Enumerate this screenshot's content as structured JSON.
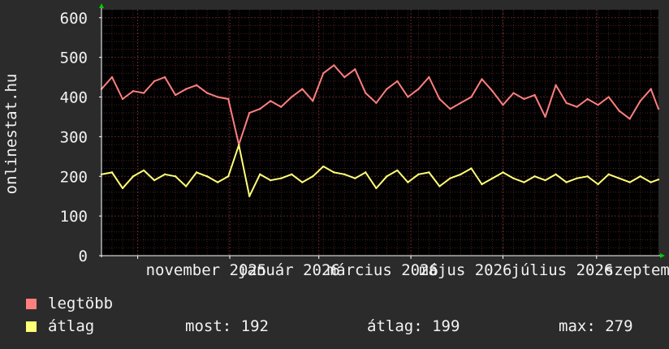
{
  "site_label": "onlinestat.hu",
  "legend": {
    "max_label": "legtöbb",
    "avg_label": "átlag",
    "now_text": "most: 192",
    "avg_text": "átlag: 199",
    "max_text": "max: 279"
  },
  "colors": {
    "background": "#2b2b2b",
    "plot_background": "#000000",
    "grid": "#4a2020",
    "max_series": "#ff7f7f",
    "avg_series": "#ffff77",
    "axis": "#ffffff",
    "arrow": "#00cc00"
  },
  "chart_data": {
    "type": "line",
    "title": "",
    "xlabel": "",
    "ylabel": "onlinestat.hu",
    "ylim": [
      0,
      620
    ],
    "yticks": [
      0,
      100,
      200,
      300,
      400,
      500,
      600
    ],
    "xlim": [
      "2025-10-08",
      "2026-10-12"
    ],
    "x_ticks": [
      {
        "date": "2025-11-01",
        "label": "november 2025"
      },
      {
        "date": "2026-01-01",
        "label": "január 2026"
      },
      {
        "date": "2026-03-01",
        "label": "március 2026"
      },
      {
        "date": "2026-05-01",
        "label": "május 2026"
      },
      {
        "date": "2026-07-01",
        "label": "július 2026"
      },
      {
        "date": "2026-09-01",
        "label": "szeptember"
      }
    ],
    "grid": true,
    "series": [
      {
        "name": "legtöbb",
        "color": "#ff7f7f",
        "x": [
          "2025-10-08",
          "2025-10-15",
          "2025-10-22",
          "2025-10-29",
          "2025-11-05",
          "2025-11-12",
          "2025-11-19",
          "2025-11-26",
          "2025-12-03",
          "2025-12-10",
          "2025-12-17",
          "2025-12-24",
          "2025-12-31",
          "2026-01-07",
          "2026-01-14",
          "2026-01-21",
          "2026-01-28",
          "2026-02-04",
          "2026-02-11",
          "2026-02-18",
          "2026-02-25",
          "2026-03-04",
          "2026-03-11",
          "2026-03-18",
          "2026-03-25",
          "2026-04-01",
          "2026-04-08",
          "2026-04-15",
          "2026-04-22",
          "2026-04-29",
          "2026-05-06",
          "2026-05-13",
          "2026-05-20",
          "2026-05-27",
          "2026-06-03",
          "2026-06-10",
          "2026-06-17",
          "2026-06-24",
          "2026-07-01",
          "2026-07-08",
          "2026-07-15",
          "2026-07-22",
          "2026-07-29",
          "2026-08-05",
          "2026-08-12",
          "2026-08-19",
          "2026-08-26",
          "2026-09-02",
          "2026-09-09",
          "2026-09-16",
          "2026-09-23",
          "2026-09-30",
          "2026-10-07",
          "2026-10-12"
        ],
        "values": [
          420,
          450,
          395,
          415,
          410,
          440,
          450,
          405,
          420,
          430,
          410,
          400,
          395,
          280,
          360,
          370,
          390,
          375,
          400,
          420,
          390,
          460,
          480,
          450,
          470,
          410,
          385,
          420,
          440,
          400,
          420,
          450,
          395,
          370,
          385,
          400,
          445,
          415,
          380,
          410,
          395,
          405,
          350,
          430,
          385,
          375,
          395,
          380,
          400,
          365,
          345,
          390,
          420,
          370
        ]
      },
      {
        "name": "átlag",
        "color": "#ffff77",
        "x": [
          "2025-10-08",
          "2025-10-15",
          "2025-10-22",
          "2025-10-29",
          "2025-11-05",
          "2025-11-12",
          "2025-11-19",
          "2025-11-26",
          "2025-12-03",
          "2025-12-10",
          "2025-12-17",
          "2025-12-24",
          "2025-12-31",
          "2026-01-07",
          "2026-01-14",
          "2026-01-21",
          "2026-01-28",
          "2026-02-04",
          "2026-02-11",
          "2026-02-18",
          "2026-02-25",
          "2026-03-04",
          "2026-03-11",
          "2026-03-18",
          "2026-03-25",
          "2026-04-01",
          "2026-04-08",
          "2026-04-15",
          "2026-04-22",
          "2026-04-29",
          "2026-05-06",
          "2026-05-13",
          "2026-05-20",
          "2026-05-27",
          "2026-06-03",
          "2026-06-10",
          "2026-06-17",
          "2026-06-24",
          "2026-07-01",
          "2026-07-08",
          "2026-07-15",
          "2026-07-22",
          "2026-07-29",
          "2026-08-05",
          "2026-08-12",
          "2026-08-19",
          "2026-08-26",
          "2026-09-02",
          "2026-09-09",
          "2026-09-16",
          "2026-09-23",
          "2026-09-30",
          "2026-10-07",
          "2026-10-12"
        ],
        "values": [
          205,
          210,
          170,
          200,
          215,
          190,
          205,
          200,
          175,
          210,
          200,
          185,
          200,
          279,
          150,
          205,
          190,
          195,
          205,
          185,
          200,
          225,
          210,
          205,
          195,
          210,
          170,
          200,
          215,
          185,
          205,
          210,
          175,
          195,
          205,
          220,
          180,
          195,
          210,
          195,
          185,
          200,
          190,
          205,
          185,
          195,
          200,
          180,
          205,
          195,
          185,
          200,
          185,
          192
        ]
      }
    ]
  }
}
